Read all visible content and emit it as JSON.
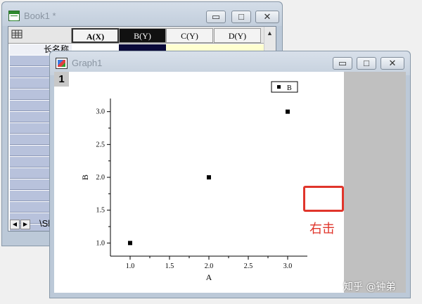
{
  "workbook": {
    "title": "Book1 *",
    "columns": [
      "A(X)",
      "B(Y)",
      "C(Y)",
      "D(Y)"
    ],
    "long_name_label": "长名称",
    "sheet_tab": "\\Sh"
  },
  "graph_window": {
    "title": "Graph1",
    "layer_number": "1"
  },
  "window_buttons": {
    "minimize": "▭",
    "restore": "□",
    "close": "✕"
  },
  "annotation": {
    "label": "右击",
    "color": "#e0352b"
  },
  "watermark": "知乎 @钟弟",
  "chart_data": {
    "type": "scatter",
    "series": [
      {
        "name": "B",
        "x": [
          1.0,
          2.0,
          3.0
        ],
        "y": [
          1.0,
          2.0,
          3.0
        ]
      }
    ],
    "xlabel": "A",
    "ylabel": "B",
    "xlim": [
      0.75,
      3.25
    ],
    "ylim": [
      0.8,
      3.2
    ],
    "xticks": [
      "1.0",
      "1.5",
      "2.0",
      "2.5",
      "3.0"
    ],
    "yticks": [
      "1.0",
      "1.5",
      "2.0",
      "2.5",
      "3.0"
    ],
    "legend_position": "top-right",
    "grid": false
  }
}
